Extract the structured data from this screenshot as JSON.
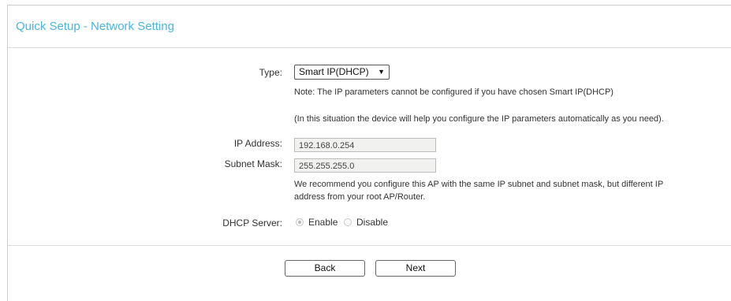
{
  "page": {
    "title": "Quick Setup - Network Setting"
  },
  "form": {
    "type": {
      "label": "Type:",
      "selected": "Smart IP(DHCP)",
      "note": "Note: The IP parameters cannot be configured if you have chosen Smart IP(DHCP)",
      "explanation": "(In this situation the device will help you configure the IP parameters automatically as you need)."
    },
    "ip_address": {
      "label": "IP Address:",
      "value": "192.168.0.254"
    },
    "subnet_mask": {
      "label": "Subnet Mask:",
      "value": "255.255.255.0"
    },
    "recommendation_line1": "We recommend you configure this AP with the same IP subnet and subnet mask, but different IP",
    "recommendation_line2": "address from your root AP/Router.",
    "dhcp_server": {
      "label": "DHCP Server:",
      "options": [
        {
          "label": "Enable",
          "selected": true
        },
        {
          "label": "Disable",
          "selected": false
        }
      ]
    }
  },
  "buttons": {
    "back": "Back",
    "next": "Next"
  },
  "icons": {
    "dropdown": "chevron-down-icon"
  }
}
